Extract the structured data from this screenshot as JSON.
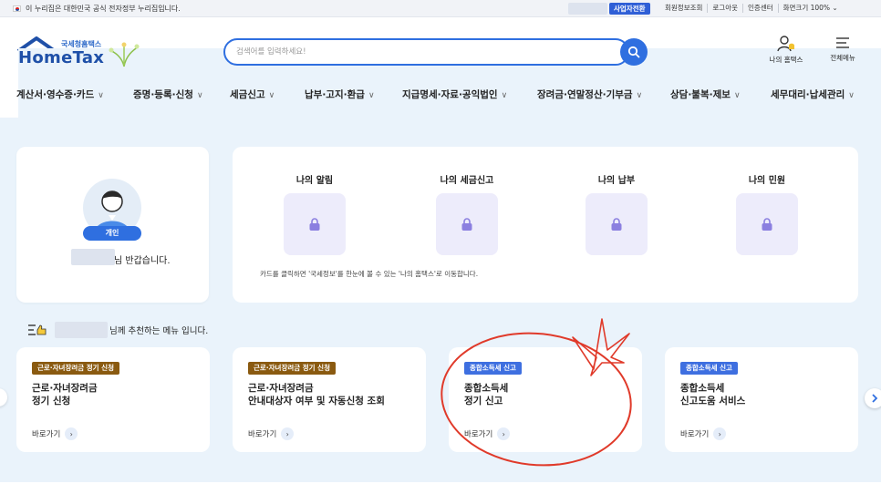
{
  "topbar": {
    "notice": "이 누리집은 대한민국 공식 전자정부 누리집입니다.",
    "biz_switch": "사업자전환",
    "links": [
      "회원정보조회",
      "로그아웃",
      "인증센터",
      "화면크기 100% ⌄"
    ]
  },
  "header": {
    "logo_sub": "국세청홈택스",
    "logo_main": "HomeTax",
    "search_placeholder": "검색어를 입력하세요!",
    "my_hometax": "나의 홈택스",
    "all_menu": "전체메뉴"
  },
  "nav": [
    "계산서·영수증·카드",
    "증명·등록·신청",
    "세금신고",
    "납부·고지·환급",
    "지급명세·자료·공익법인",
    "장려금·연말정산·기부금",
    "상담·불복·제보",
    "세무대리·납세관리"
  ],
  "profile": {
    "badge": "개인",
    "greeting": "님 반갑습니다."
  },
  "my_cards": {
    "items": [
      "나의 알림",
      "나의 세금신고",
      "나의 납부",
      "나의 민원"
    ],
    "hint": "카드를 클릭하면 '국세정보'를 한눈에 볼 수 있는 '나의 홈택스'로 이동합니다."
  },
  "recommend": {
    "title_suffix": "님께 추천하는 메뉴 입니다.",
    "cards": [
      {
        "tag": "근로·자녀장려금 정기 신청",
        "title": "근로·자녀장려금\n정기 신청",
        "link": "바로가기"
      },
      {
        "tag": "근로·자녀장려금 정기 신청",
        "title": "근로·자녀장려금\n안내대상자 여부 및 자동신청 조회",
        "link": "바로가기"
      },
      {
        "tag": "종합소득세 신고",
        "title": "종합소득세\n정기 신고",
        "link": "바로가기"
      },
      {
        "tag": "종합소득세 신고",
        "title": "종합소득세\n신고도움 서비스",
        "link": "바로가기"
      }
    ]
  },
  "colors": {
    "primary": "#2f6fe0",
    "tag_brown": "#8a5a10",
    "tag_blue": "#3e6fe0",
    "bg": "#eaf3fb",
    "annotation": "#e03a2a"
  }
}
